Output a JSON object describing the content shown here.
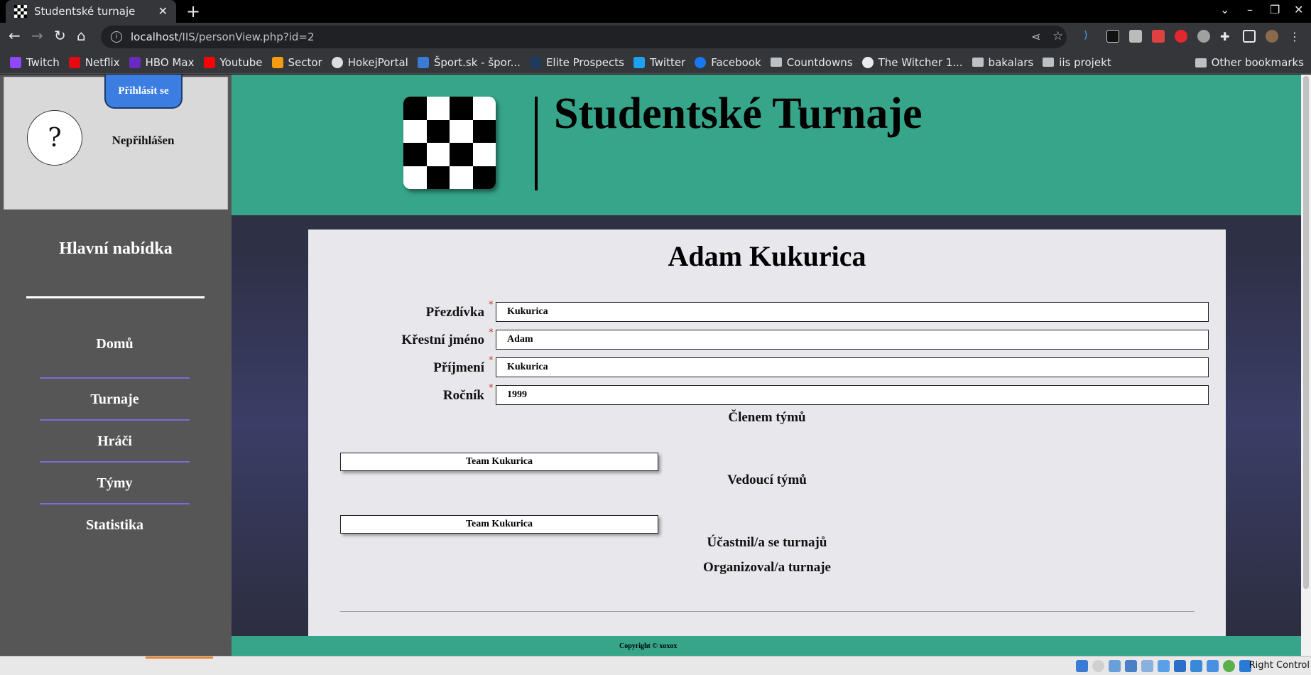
{
  "browser": {
    "tab_title": "Studentské turnaje",
    "url_host": "localhost",
    "url_path": "/IIS/personView.php?id=2",
    "bookmarks": [
      {
        "label": "Twitch",
        "color": "#9146ff",
        "kind": "site"
      },
      {
        "label": "Netflix",
        "color": "#e50914",
        "kind": "site"
      },
      {
        "label": "HBO Max",
        "color": "#6a2ac1",
        "kind": "site"
      },
      {
        "label": "Youtube",
        "color": "#ff0000",
        "kind": "site"
      },
      {
        "label": "Sector",
        "color": "#f39c12",
        "kind": "site"
      },
      {
        "label": "HokejPortal",
        "color": "#dddddd",
        "kind": "site"
      },
      {
        "label": "Šport.sk - špor...",
        "color": "#3a7bd5",
        "kind": "site"
      },
      {
        "label": "Elite Prospects",
        "color": "#1e3a5f",
        "kind": "site"
      },
      {
        "label": "Twitter",
        "color": "#1da1f2",
        "kind": "site"
      },
      {
        "label": "Facebook",
        "color": "#1877f2",
        "kind": "site"
      },
      {
        "label": "Countdowns",
        "kind": "folder"
      },
      {
        "label": "The Witcher 1...",
        "color": "#e8eaed",
        "kind": "site"
      },
      {
        "label": "bakalars",
        "kind": "folder"
      },
      {
        "label": "iis projekt",
        "kind": "folder"
      }
    ],
    "other_bookmarks": "Other bookmarks"
  },
  "sidebar": {
    "login_button": "Přihlásit se",
    "avatar_glyph": "?",
    "user_status": "Nepřihlášen",
    "menu_title": "Hlavní nabídka",
    "menu_items": [
      "Domů",
      "Turnaje",
      "Hráči",
      "Týmy",
      "Statistika"
    ]
  },
  "header": {
    "site_title": "Studentské Turnaje"
  },
  "person": {
    "name": "Adam Kukurica",
    "fields": [
      {
        "label": "Přezdívka",
        "value": "Kukurica",
        "required": "*"
      },
      {
        "label": "Křestní jméno",
        "value": "Adam",
        "required": "*"
      },
      {
        "label": "Příjmení",
        "value": "Kukurica",
        "required": "*"
      },
      {
        "label": "Ročník",
        "value": "1999",
        "required": "*"
      }
    ],
    "member_title": "Členem týmů",
    "member_teams": [
      "Team Kukurica"
    ],
    "leader_title": "Vedoucí týmů",
    "leader_teams": [
      "Team Kukurica"
    ],
    "participated_title": "Účastnil/a se turnajů",
    "organized_title": "Organizoval/a turnaje"
  },
  "footer": {
    "copyright": "Copyright © xoxox"
  },
  "taskbar": {
    "right_control": "Right Control"
  },
  "colors": {
    "header_green": "#36a58a",
    "sidebar_gray": "#565656",
    "login_blue": "#3b7de0",
    "menu_separator": "#7c6bd8",
    "required_red": "#c0392b"
  }
}
